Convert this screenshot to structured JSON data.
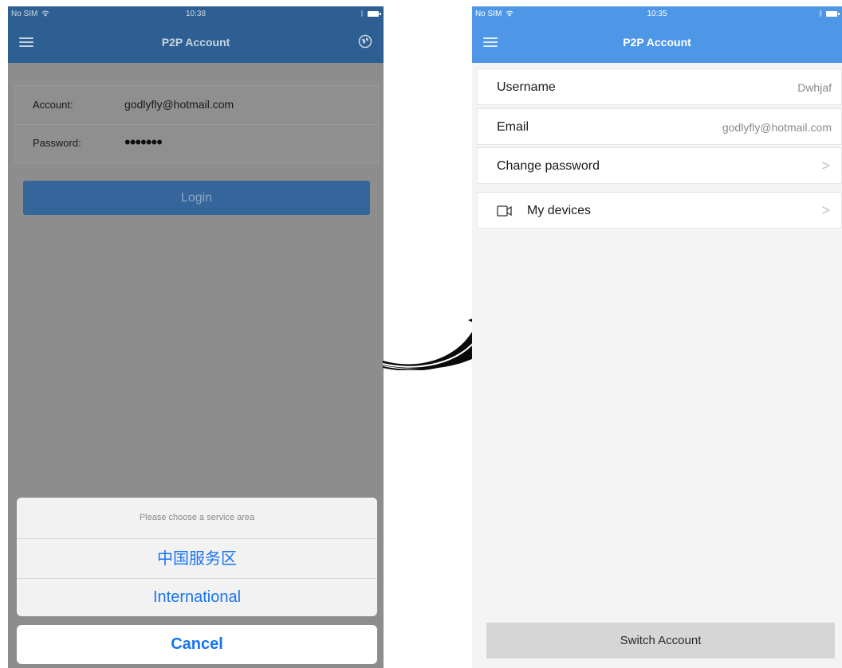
{
  "left_screen": {
    "status": {
      "carrier": "No SIM",
      "time": "10:38"
    },
    "nav_title": "P2P Account",
    "form": {
      "account_label": "Account:",
      "account_value": "godlyfly@hotmail.com",
      "password_label": "Password:",
      "password_value": "•••••••"
    },
    "login_label": "Login",
    "action_sheet": {
      "title": "Please choose a service area",
      "options": [
        "中国服务区",
        "International"
      ],
      "cancel_label": "Cancel"
    }
  },
  "right_screen": {
    "status": {
      "carrier": "No SIM",
      "time": "10:35"
    },
    "nav_title": "P2P Account",
    "rows": [
      {
        "label": "Username",
        "value": "Dwhjaf"
      },
      {
        "label": "Email",
        "value": "godlyfly@hotmail.com"
      },
      {
        "label": "Change password",
        "value": ">"
      },
      {
        "label": "My devices",
        "value": ">",
        "icon": "video-camera-icon"
      }
    ],
    "switch_label": "Switch Account"
  },
  "colors": {
    "left_nav": "#2d5f92",
    "right_nav": "#4d97e6",
    "sheet_text": "#1a74f2",
    "overlay_bg": "#8d8d8d"
  },
  "icons": [
    "menu-icon",
    "globe-icon",
    "wifi-icon",
    "bluetooth-icon",
    "battery-icon",
    "chevron-right-icon",
    "video-camera-icon",
    "curved-arrow-icon"
  ]
}
